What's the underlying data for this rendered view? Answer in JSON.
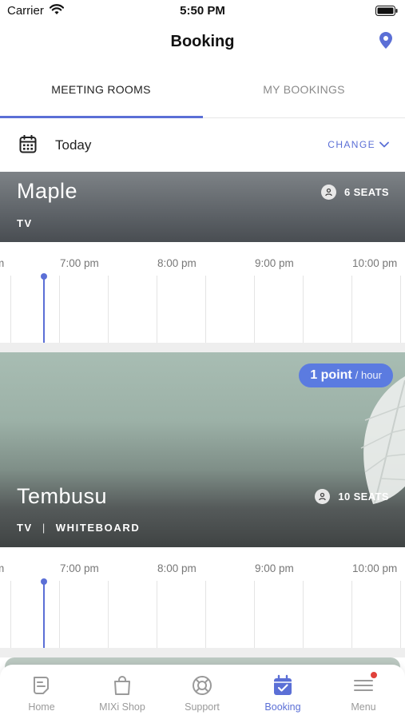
{
  "status_bar": {
    "carrier": "Carrier",
    "time": "5:50 PM"
  },
  "header": {
    "title": "Booking"
  },
  "tabs": [
    {
      "label": "MEETING ROOMS",
      "active": true
    },
    {
      "label": "MY BOOKINGS",
      "active": false
    }
  ],
  "date_selector": {
    "label": "Today",
    "change_label": "CHANGE"
  },
  "timeline_labels": [
    "m",
    "7:00 pm",
    "8:00 pm",
    "9:00 pm",
    "10:00 pm"
  ],
  "rooms": [
    {
      "name": "Maple",
      "seats": "6 SEATS",
      "amenities": [
        "TV"
      ]
    },
    {
      "name": "Tembusu",
      "seats": "10 SEATS",
      "amenities": [
        "TV",
        "WHITEBOARD"
      ],
      "points": {
        "value": "1 point",
        "unit": "/ hour"
      }
    }
  ],
  "tabbar": [
    {
      "label": "Home",
      "icon": "home-doc-icon",
      "active": false
    },
    {
      "label": "MIXi Shop",
      "icon": "shopping-bag-icon",
      "active": false
    },
    {
      "label": "Support",
      "icon": "lifebuoy-icon",
      "active": false
    },
    {
      "label": "Booking",
      "icon": "calendar-check-icon",
      "active": true
    },
    {
      "label": "Menu",
      "icon": "menu-icon",
      "active": false,
      "badge": true
    }
  ],
  "colors": {
    "accent": "#5b6fd6",
    "badge_blue": "#5b7be0",
    "notification_red": "#e0413a"
  }
}
